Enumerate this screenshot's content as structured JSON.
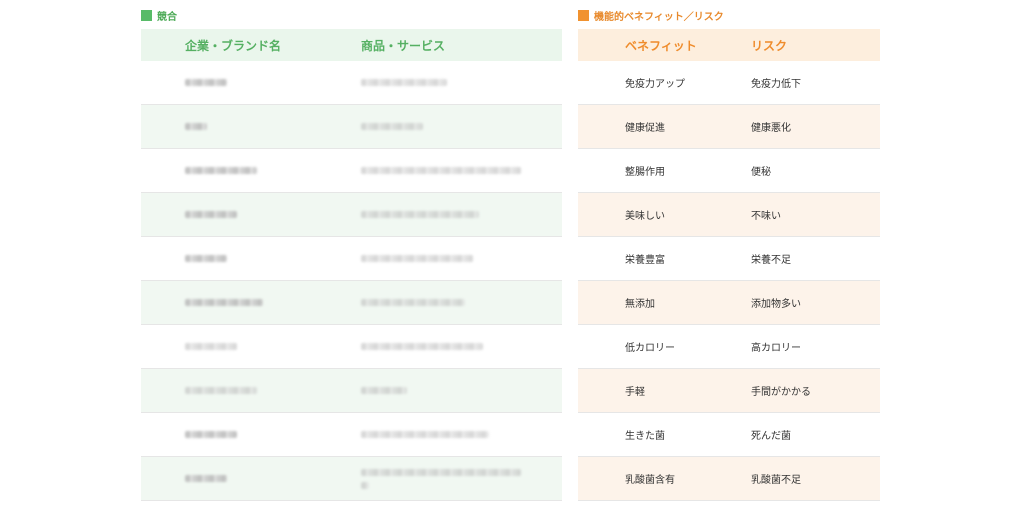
{
  "left_section": {
    "title": "競合",
    "headers": [
      "企業・ブランド名",
      "商品・サービス"
    ]
  },
  "right_section": {
    "title": "機能的ベネフィット／リスク",
    "headers": [
      "ベネフィット",
      "リスク"
    ],
    "rows": [
      {
        "benefit": "免疫力アップ",
        "risk": "免疫力低下"
      },
      {
        "benefit": "健康促進",
        "risk": "健康悪化"
      },
      {
        "benefit": "整腸作用",
        "risk": "便秘"
      },
      {
        "benefit": "美味しい",
        "risk": "不味い"
      },
      {
        "benefit": "栄養豊富",
        "risk": "栄養不足"
      },
      {
        "benefit": "無添加",
        "risk": "添加物多い"
      },
      {
        "benefit": "低カロリー",
        "risk": "高カロリー"
      },
      {
        "benefit": "手軽",
        "risk": "手間がかかる"
      },
      {
        "benefit": "生きた菌",
        "risk": "死んだ菌"
      },
      {
        "benefit": "乳酸菌含有",
        "risk": "乳酸菌不足"
      }
    ]
  },
  "colors": {
    "left_accent": "#58bb68",
    "right_accent": "#f1922f"
  }
}
